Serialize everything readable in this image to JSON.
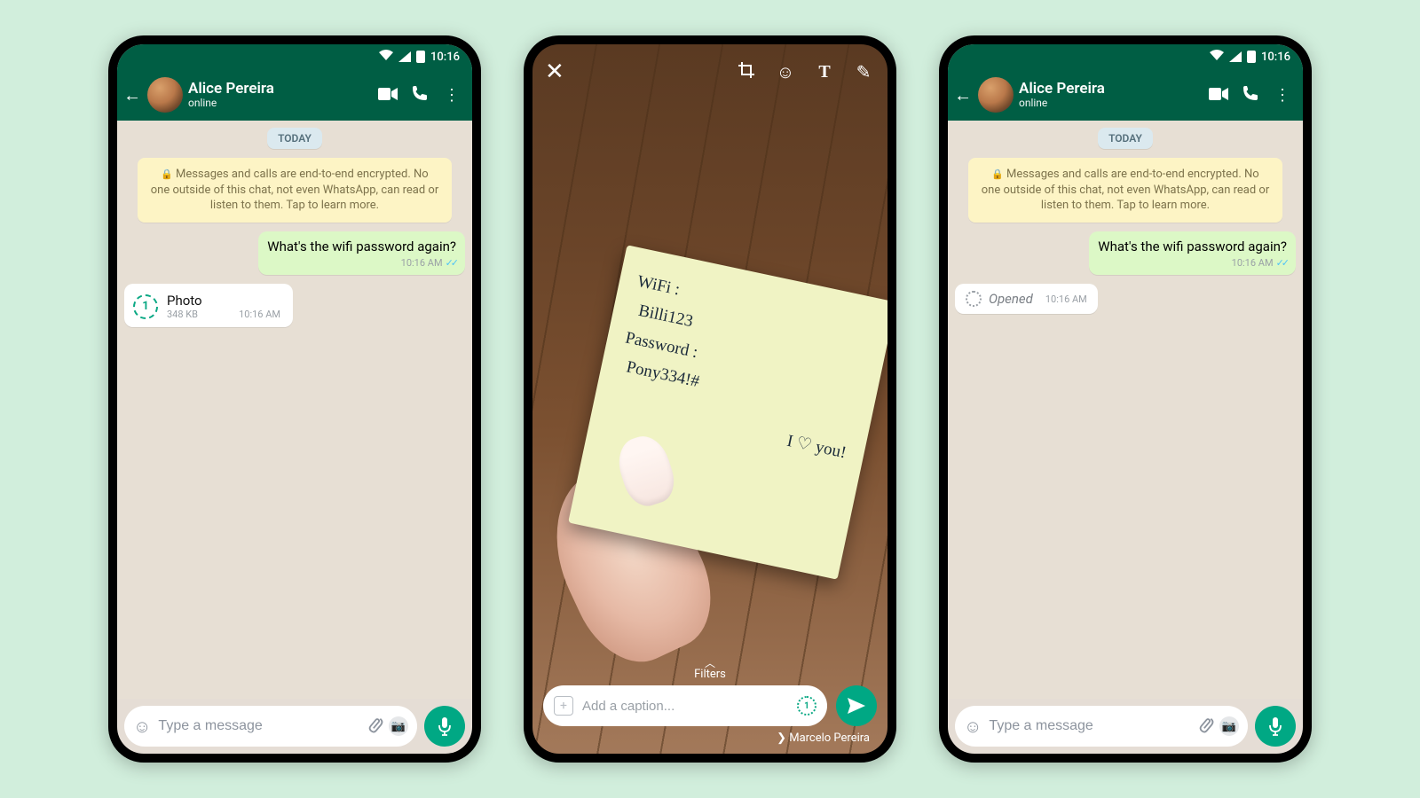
{
  "status": {
    "time": "10:16"
  },
  "chat": {
    "contact_name": "Alice Pereira",
    "subtitle": "online",
    "day_label": "TODAY",
    "encryption_notice": "Messages and calls are end-to-end encrypted. No one outside of this chat, not even WhatsApp, can read or listen to them. Tap to learn more.",
    "sent_msg": {
      "text": "What's the wifi password again?",
      "time": "10:16 AM"
    },
    "view_once": {
      "label": "Photo",
      "size": "348 KB",
      "time": "10:16 AM"
    },
    "opened": {
      "label": "Opened",
      "time": "10:16 AM"
    },
    "composer_placeholder": "Type a message"
  },
  "editor": {
    "filters_label": "Filters",
    "caption_placeholder": "Add a caption...",
    "recipient": "Marcelo Pereira",
    "note": {
      "l1": "WiFi :",
      "l2": "Billi123",
      "l3": "Password :",
      "l4": "Pony334!#",
      "l5": "I ♡ you!"
    }
  }
}
